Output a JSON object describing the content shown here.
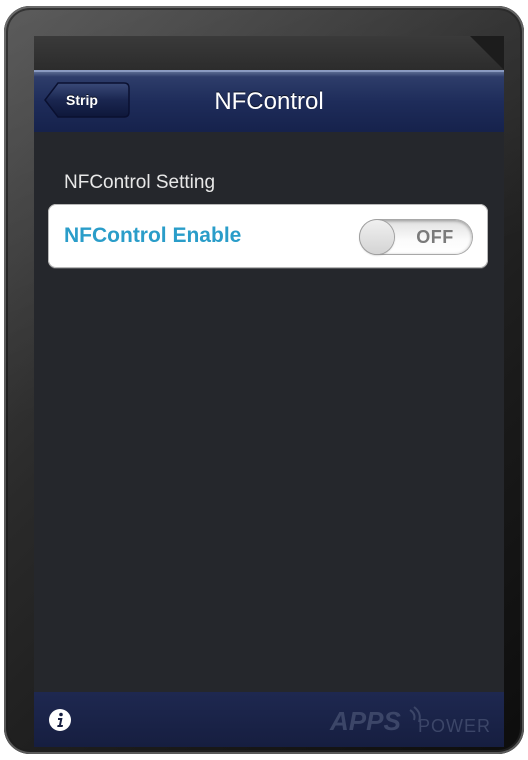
{
  "nav": {
    "back_label": "Strip",
    "title": "NFControl"
  },
  "settings": {
    "section_title": "NFControl Setting",
    "items": [
      {
        "label": "NFControl Enable",
        "state": "OFF"
      }
    ]
  },
  "footer": {
    "info_icon": "info-icon",
    "brand_logo": "APPS POWER"
  },
  "colors": {
    "nav_bar": "#1e2c5a",
    "accent_label": "#2a9dc9",
    "background": "#25272c",
    "footer": "#161e40"
  }
}
